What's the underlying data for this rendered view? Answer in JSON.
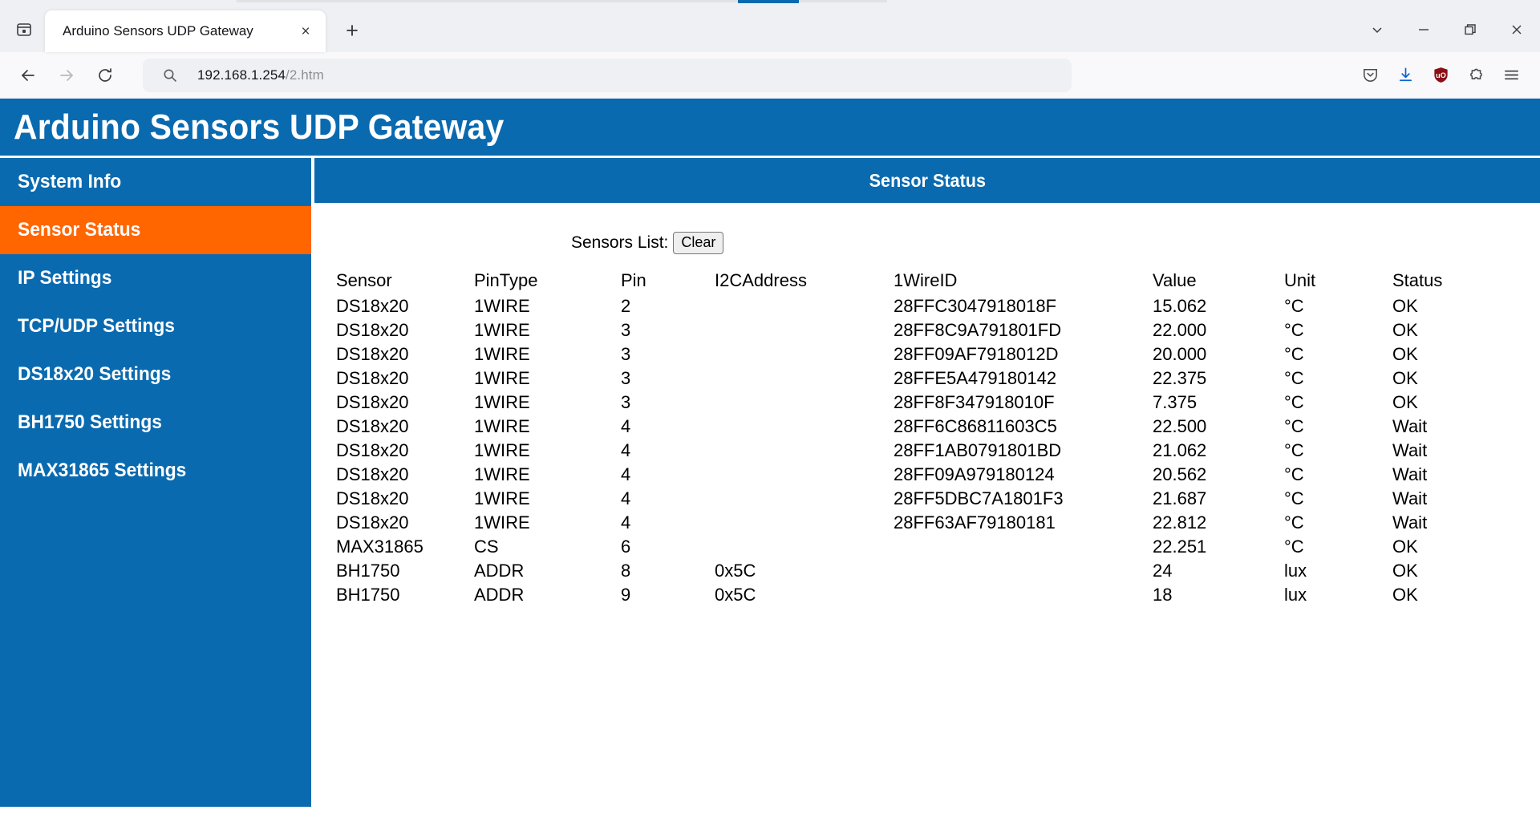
{
  "browser": {
    "tab": {
      "title": "Arduino Sensors UDP Gateway",
      "close_label": "×"
    },
    "new_tab_label": "+",
    "url": {
      "host": "192.168.1.254",
      "path": "/2.htm"
    },
    "icons": {
      "tab_list_sidebar": "sidebar-tabs-icon",
      "back": "back-arrow-icon",
      "forward": "forward-arrow-icon",
      "reload": "reload-icon",
      "search": "search-icon",
      "pocket": "pocket-save-icon",
      "downloads": "download-icon",
      "ublock": "ublock-origin-shield-icon",
      "extensions": "extensions-puzzle-icon",
      "menu": "hamburger-menu-icon",
      "list_all_tabs": "chevron-down-icon",
      "minimize": "minimize-icon",
      "maximize": "maximize-restore-icon",
      "close": "window-close-icon"
    },
    "ublock_badge": "uO"
  },
  "site": {
    "title": "Arduino Sensors UDP Gateway",
    "accent_blue": "#0a6aaf",
    "accent_orange": "#ff6600"
  },
  "sidebar": {
    "items": [
      {
        "label": "System Info",
        "active": false
      },
      {
        "label": "Sensor Status",
        "active": true
      },
      {
        "label": "IP Settings",
        "active": false
      },
      {
        "label": "TCP/UDP Settings",
        "active": false
      },
      {
        "label": "DS18x20 Settings",
        "active": false
      },
      {
        "label": "BH1750 Settings",
        "active": false
      },
      {
        "label": "MAX31865 Settings",
        "active": false
      }
    ]
  },
  "main": {
    "header": "Sensor Status",
    "list_label": "Sensors List:",
    "clear_button": "Clear",
    "table": {
      "columns": [
        "Sensor",
        "PinType",
        "Pin",
        "I2CAddress",
        "1WireID",
        "Value",
        "Unit",
        "Status"
      ],
      "rows": [
        [
          "DS18x20",
          "1WIRE",
          "2",
          "",
          "28FFC3047918018F",
          "15.062",
          "°C",
          "OK"
        ],
        [
          "DS18x20",
          "1WIRE",
          "3",
          "",
          "28FF8C9A791801FD",
          "22.000",
          "°C",
          "OK"
        ],
        [
          "DS18x20",
          "1WIRE",
          "3",
          "",
          "28FF09AF7918012D",
          "20.000",
          "°C",
          "OK"
        ],
        [
          "DS18x20",
          "1WIRE",
          "3",
          "",
          "28FFE5A479180142",
          "22.375",
          "°C",
          "OK"
        ],
        [
          "DS18x20",
          "1WIRE",
          "3",
          "",
          "28FF8F347918010F",
          "7.375",
          "°C",
          "OK"
        ],
        [
          "DS18x20",
          "1WIRE",
          "4",
          "",
          "28FF6C86811603C5",
          "22.500",
          "°C",
          "Wait"
        ],
        [
          "DS18x20",
          "1WIRE",
          "4",
          "",
          "28FF1AB0791801BD",
          "21.062",
          "°C",
          "Wait"
        ],
        [
          "DS18x20",
          "1WIRE",
          "4",
          "",
          "28FF09A979180124",
          "20.562",
          "°C",
          "Wait"
        ],
        [
          "DS18x20",
          "1WIRE",
          "4",
          "",
          "28FF5DBC7A1801F3",
          "21.687",
          "°C",
          "Wait"
        ],
        [
          "DS18x20",
          "1WIRE",
          "4",
          "",
          "28FF63AF79180181",
          "22.812",
          "°C",
          "Wait"
        ],
        [
          "MAX31865",
          "CS",
          "6",
          "",
          "",
          "22.251",
          "°C",
          "OK"
        ],
        [
          "BH1750",
          "ADDR",
          "8",
          "0x5C",
          "",
          "24",
          "lux",
          "OK"
        ],
        [
          "BH1750",
          "ADDR",
          "9",
          "0x5C",
          "",
          "18",
          "lux",
          "OK"
        ]
      ]
    }
  }
}
